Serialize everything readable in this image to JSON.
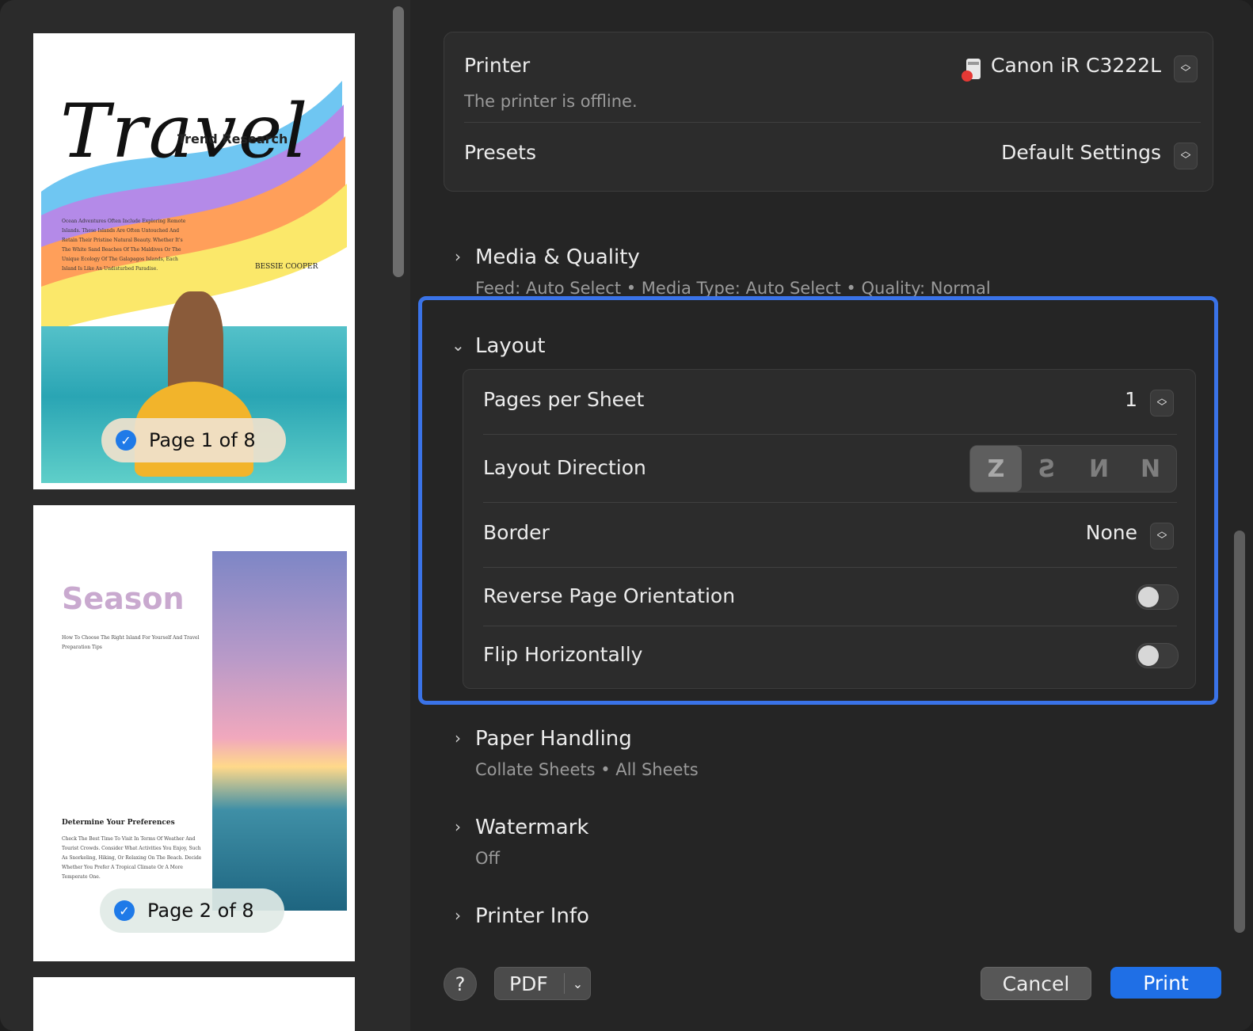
{
  "preview": {
    "page1": {
      "title": "Travel",
      "subtitle": "Trend Research",
      "body": "Ocean Adventures Often Include Exploring Remote Islands. These Islands Are Often Untouched And Retain Their Pristine Natural Beauty. Whether It's The White Sand Beaches Of The Maldives Or The Unique Ecology Of The Galapagos Islands, Each Island Is Like An Undisturbed Paradise.",
      "author": "BESSIE COOPER",
      "badge": "Page 1 of 8"
    },
    "page2": {
      "title": "Season",
      "body": "How To Choose The Right Island For Yourself And Travel Preparation Tips",
      "heading": "Determine Your Preferences",
      "body2": "Check The Best Time To Visit In Terms Of Weather And Tourist Crowds. Consider What Activities You Enjoy, Such As Snorkeling, Hiking, Or Relaxing On The Beach. Decide Whether You Prefer A Tropical Climate Or A More Temperate One.",
      "badge": "Page 2 of 8"
    },
    "check_glyph": "✓"
  },
  "printer": {
    "label": "Printer",
    "value": "Canon iR C3222L",
    "status": "The printer is offline."
  },
  "presets": {
    "label": "Presets",
    "value": "Default Settings"
  },
  "media_quality": {
    "title": "Media & Quality",
    "summary": "Feed: Auto Select • Media Type: Auto Select • Quality: Normal"
  },
  "layout": {
    "title": "Layout",
    "pages_per_sheet": {
      "label": "Pages per Sheet",
      "value": "1"
    },
    "layout_direction": {
      "label": "Layout Direction",
      "options": [
        "Z",
        "Ƨ",
        "И",
        "N"
      ],
      "selected": 0
    },
    "border": {
      "label": "Border",
      "value": "None"
    },
    "reverse_page_orientation": {
      "label": "Reverse Page Orientation",
      "on": false
    },
    "flip_horizontally": {
      "label": "Flip Horizontally",
      "on": false
    }
  },
  "paper_handling": {
    "title": "Paper Handling",
    "summary": "Collate Sheets • All Sheets"
  },
  "watermark": {
    "title": "Watermark",
    "summary": "Off"
  },
  "printer_info": {
    "title": "Printer Info"
  },
  "footer": {
    "help": "?",
    "pdf": "PDF",
    "cancel": "Cancel",
    "print": "Print"
  },
  "colors": {
    "accent": "#1f6fe6",
    "highlight": "#3a73e8",
    "background": "#252525"
  }
}
